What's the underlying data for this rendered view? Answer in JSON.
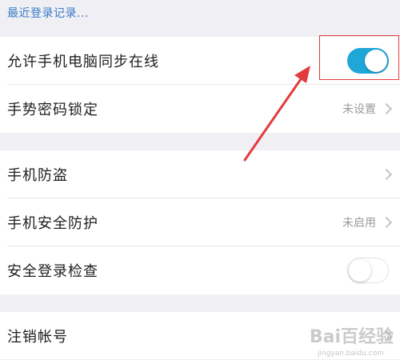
{
  "top_link": "最近登录记录...",
  "group1": {
    "sync_online_label": "允许手机电脑同步在线",
    "sync_online_enabled": true,
    "gesture_lock_label": "手势密码锁定",
    "gesture_lock_value": "未设置"
  },
  "group2": {
    "phone_antitheft_label": "手机防盗",
    "phone_protection_label": "手机安全防护",
    "phone_protection_value": "未启用",
    "login_check_label": "安全登录检查",
    "login_check_enabled": false
  },
  "group3": {
    "logout_account_label": "注销帐号"
  },
  "watermark": {
    "main": "Bai百经验",
    "sub": "jingyan.baidu.com"
  },
  "colors": {
    "toggle_on": "#1fa7d8",
    "link": "#3a7bc8",
    "annotation_red": "#e23b3b"
  },
  "icons": [
    "chevron-right-icon",
    "annotation-arrow-icon"
  ]
}
